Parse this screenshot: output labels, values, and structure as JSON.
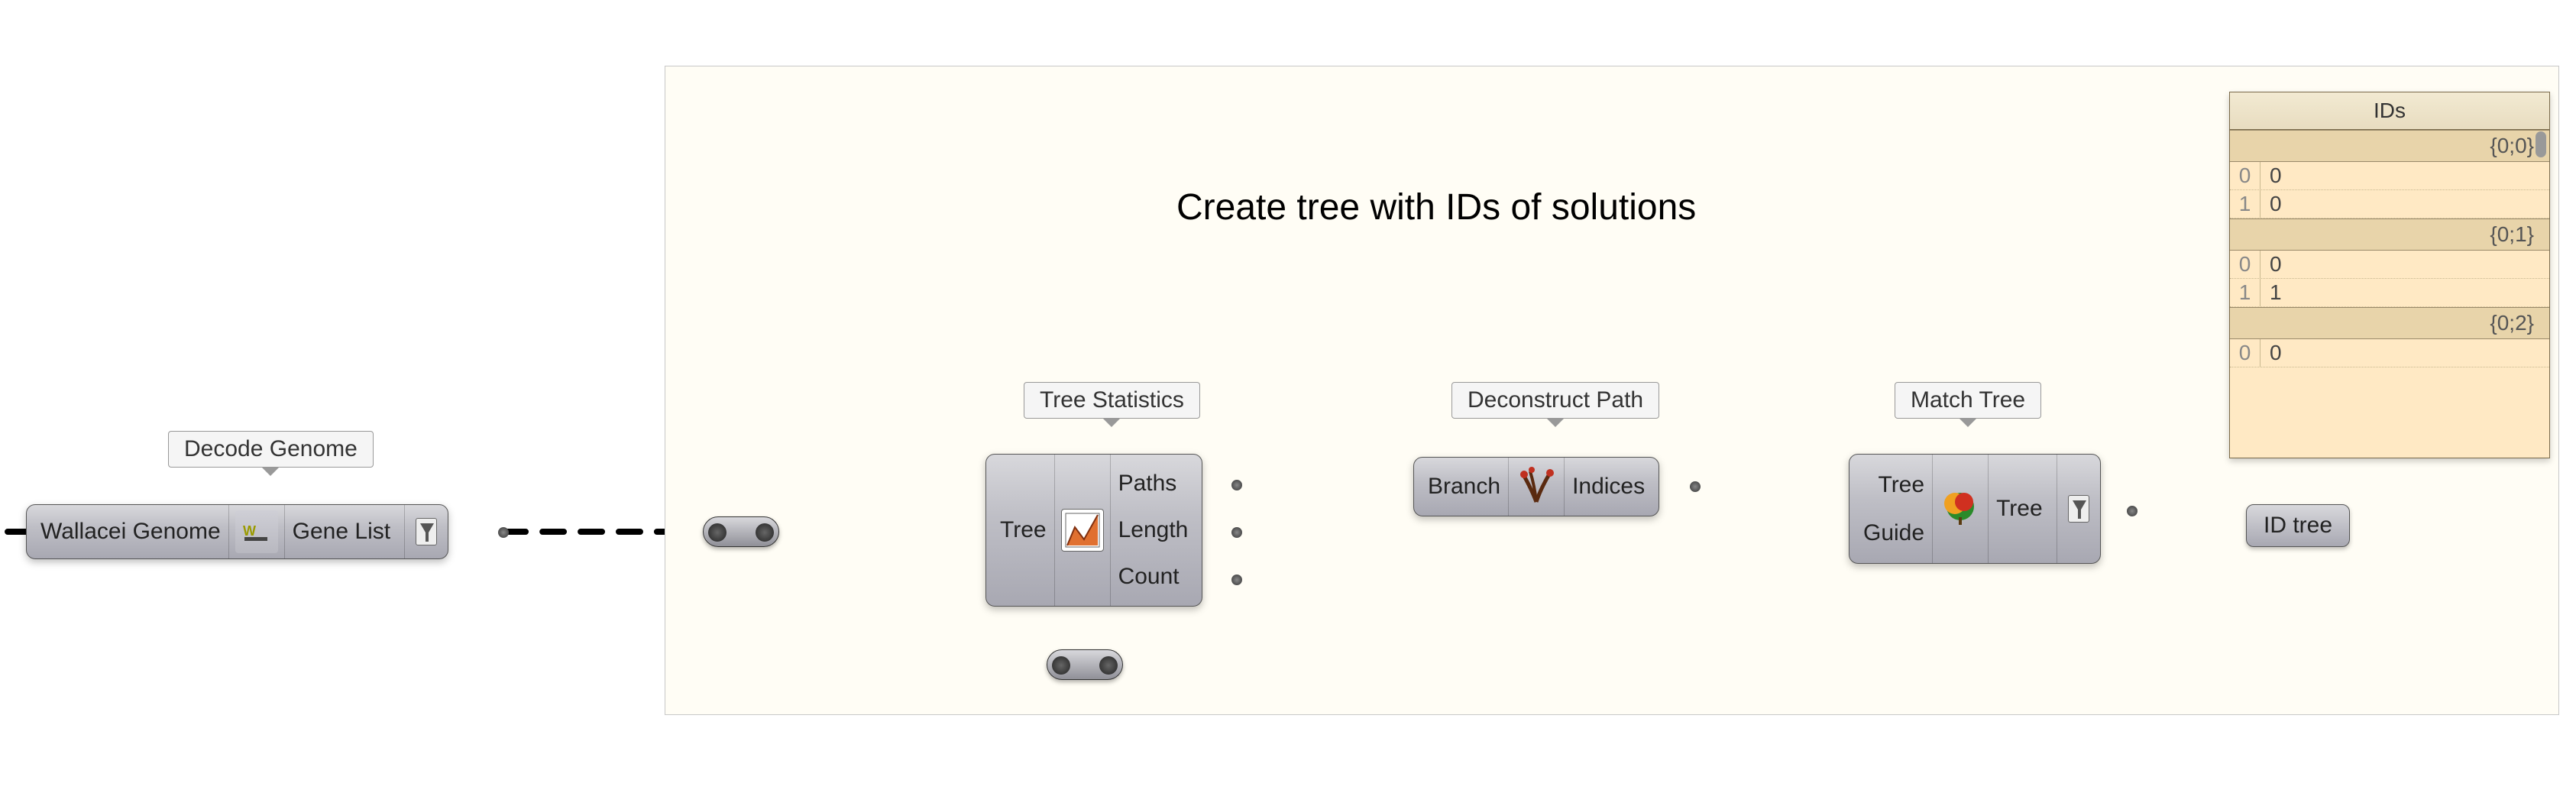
{
  "group": {
    "title": "Create tree with IDs of solutions"
  },
  "labels": {
    "decode_genome": "Decode Genome",
    "tree_statistics": "Tree Statistics",
    "deconstruct_path": "Deconstruct Path",
    "match_tree": "Match Tree"
  },
  "components": {
    "decode_genome": {
      "inputs": [
        "Wallacei Genome"
      ],
      "outputs": [
        "Gene List"
      ],
      "icon": "wallacei"
    },
    "tree_statistics": {
      "inputs": [
        "Tree"
      ],
      "outputs": [
        "Paths",
        "Length",
        "Count"
      ],
      "icon": "tree-stats"
    },
    "deconstruct_path": {
      "inputs": [
        "Branch"
      ],
      "outputs": [
        "Indices"
      ],
      "icon": "deconstruct"
    },
    "match_tree": {
      "inputs": [
        "Tree",
        "Guide"
      ],
      "outputs": [
        "Tree"
      ],
      "icon": "match"
    }
  },
  "param": {
    "id_tree": "ID tree"
  },
  "panel": {
    "title": "IDs",
    "branches": [
      {
        "path": "{0;0}",
        "items": [
          {
            "i": "0",
            "v": "0"
          },
          {
            "i": "1",
            "v": "0"
          }
        ]
      },
      {
        "path": "{0;1}",
        "items": [
          {
            "i": "0",
            "v": "0"
          },
          {
            "i": "1",
            "v": "1"
          }
        ]
      },
      {
        "path": "{0;2}",
        "items": [
          {
            "i": "0",
            "v": "0"
          }
        ]
      }
    ]
  }
}
